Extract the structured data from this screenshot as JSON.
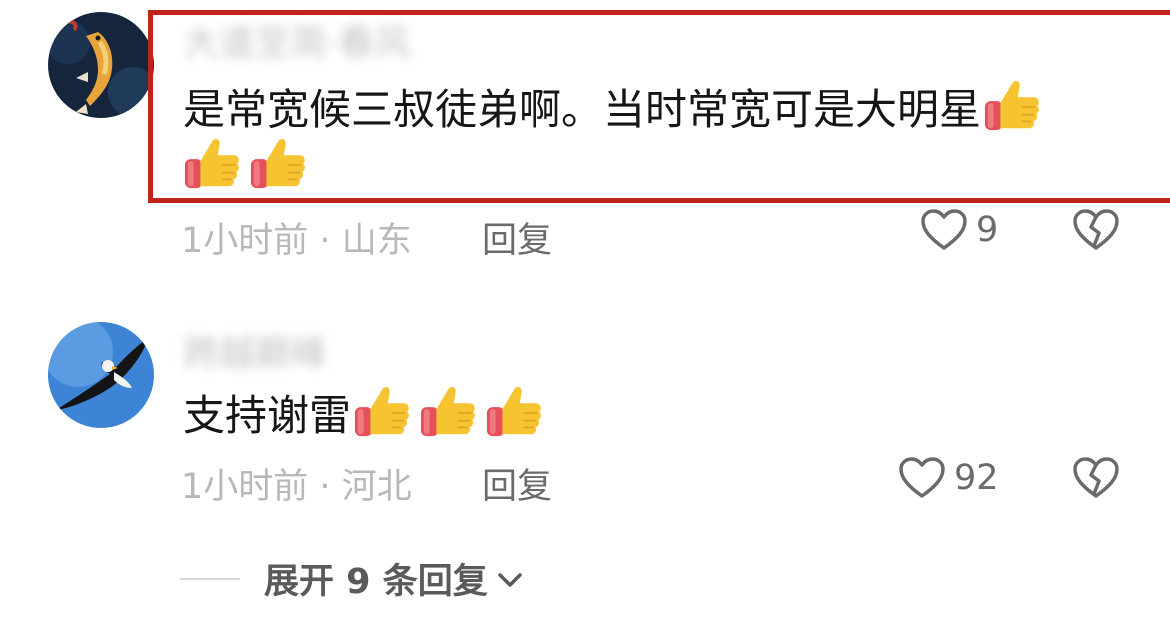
{
  "comments": [
    {
      "username": "大道至简·春风",
      "text_line1": "是常宽候三叔徒弟啊。当时常宽可是大明星",
      "time": "1小时前",
      "separator": "·",
      "location": "山东",
      "reply_label": "回复",
      "likes": "9",
      "trailing_thumbs": 1,
      "second_line_thumbs": 2,
      "highlighted": true,
      "avatar_icon": "koi-fish-avatar"
    },
    {
      "username": "跨越巅峰",
      "text_line1": "支持谢雷",
      "time": "1小时前",
      "separator": "·",
      "location": "河北",
      "reply_label": "回复",
      "likes": "92",
      "trailing_thumbs": 3,
      "highlighted": false,
      "avatar_icon": "eagle-avatar"
    }
  ],
  "expand_replies": {
    "label": "展开 9 条回复",
    "icon": "chevron-down-icon"
  },
  "colors": {
    "highlight_border": "#c0221c",
    "meta_text": "#b8b8b8",
    "action_text": "#6a6a6a",
    "thumb_yellow": "#f7c431",
    "cuff_red": "#e6505b"
  }
}
